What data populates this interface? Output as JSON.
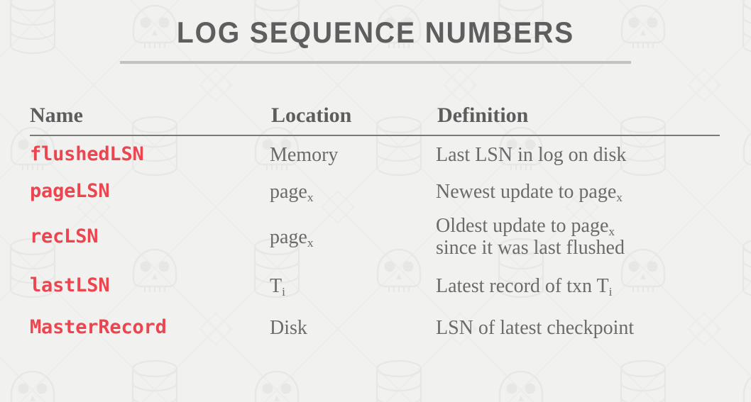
{
  "slide": {
    "title": "Log Sequence Numbers",
    "background_color": "#f1f1f0",
    "title_color": "#5e5e5e",
    "title_rule_color": "#c2c2c2",
    "accent_color": "#ec4550",
    "body_text_color": "#6b6b6b",
    "header_rule_color": "#7a7a7a"
  },
  "table": {
    "headers": {
      "name": "Name",
      "location": "Location",
      "definition": "Definition"
    },
    "rows": [
      {
        "key": "flushedLSN",
        "name": "flushedLSN",
        "location": "Memory",
        "location_sub": "",
        "definition_line1": "Last LSN in log on disk",
        "definition_line1_sub": "",
        "definition_line2": ""
      },
      {
        "key": "pageLSN",
        "name": "pageLSN",
        "location": "page",
        "location_sub": "x",
        "definition_line1": "Newest update to page",
        "definition_line1_sub": "x",
        "definition_line2": ""
      },
      {
        "key": "recLSN",
        "name": "recLSN",
        "location": "page",
        "location_sub": "x",
        "definition_line1": "Oldest update to page",
        "definition_line1_sub": "x",
        "definition_line2": "since it was last flushed"
      },
      {
        "key": "lastLSN",
        "name": "lastLSN",
        "location": "T",
        "location_sub": "i",
        "definition_line1": "Latest record of txn T",
        "definition_line1_sub": "i",
        "definition_line2": ""
      },
      {
        "key": "MasterRecord",
        "name": "MasterRecord",
        "location": "Disk",
        "location_sub": "",
        "definition_line1": "LSN of latest checkpoint",
        "definition_line1_sub": "",
        "definition_line2": ""
      }
    ]
  },
  "watermark": {
    "icons": [
      "database-cylinder-icon",
      "skull-icon",
      "diamond-outline-icon"
    ],
    "color": "#e8e8e6",
    "tile_size": 172
  }
}
